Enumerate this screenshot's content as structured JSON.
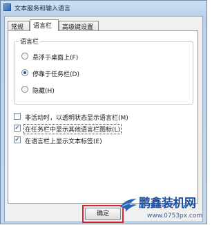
{
  "window": {
    "title": "文本服务和输入语言"
  },
  "tabs": [
    {
      "label": "常规"
    },
    {
      "label": "语言栏"
    },
    {
      "label": "高级键设置"
    }
  ],
  "language_bar": {
    "group_label": "语言栏",
    "options": [
      {
        "label": "悬浮于桌面上(F)",
        "selected": false
      },
      {
        "label": "停靠于任务栏(D)",
        "selected": true
      },
      {
        "label": "隐藏(H)",
        "selected": false
      }
    ]
  },
  "checkboxes": [
    {
      "label": "非活动时，以透明状态显示语言栏(M)",
      "checked": false
    },
    {
      "label": "在任务栏中显示其他语言栏图标(L)",
      "checked": true
    },
    {
      "label": "在语言栏上显示文本标签(E)",
      "checked": true
    }
  ],
  "buttons": {
    "ok": "确定"
  },
  "watermark": {
    "name": "鹏鑫装机网",
    "url": "www.0753px.com"
  },
  "colors": {
    "highlight": "#e0202a",
    "brand": "#1d4fa3"
  }
}
